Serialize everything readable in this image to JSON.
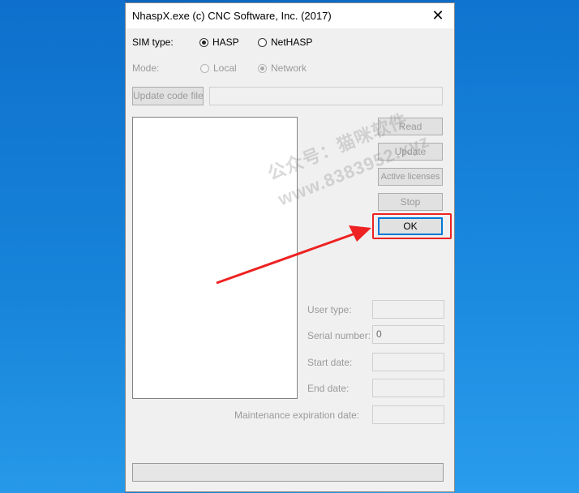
{
  "window": {
    "title": "NhaspX.exe (c) CNC Software, Inc. (2017)",
    "close_symbol": "✕"
  },
  "sim_type": {
    "label": "SIM type:",
    "options": [
      "HASP",
      "NetHASP"
    ],
    "selected": "HASP"
  },
  "mode": {
    "label": "Mode:",
    "options": [
      "Local",
      "Network"
    ],
    "selected": "Network"
  },
  "update_code_file": {
    "button_label": "Update code file",
    "path_value": ""
  },
  "buttons": {
    "read": "Read",
    "update": "Update",
    "active_licenses": "Active licenses",
    "stop": "Stop",
    "ok": "OK"
  },
  "info": {
    "user_type_label": "User type:",
    "user_type_value": "",
    "serial_number_label": "Serial number:",
    "serial_number_value": "0",
    "start_date_label": "Start date:",
    "start_date_value": "",
    "end_date_label": "End date:",
    "end_date_value": "",
    "maintenance_label": "Maintenance expiration date:",
    "maintenance_value": ""
  },
  "status_bar": "",
  "watermark": {
    "line1": "公众号：猫咪软件",
    "line2": "www.8383952.xyz"
  },
  "colors": {
    "highlight": "#ee2222",
    "arrow": "#ee2222",
    "ok_border": "#0078d7"
  }
}
